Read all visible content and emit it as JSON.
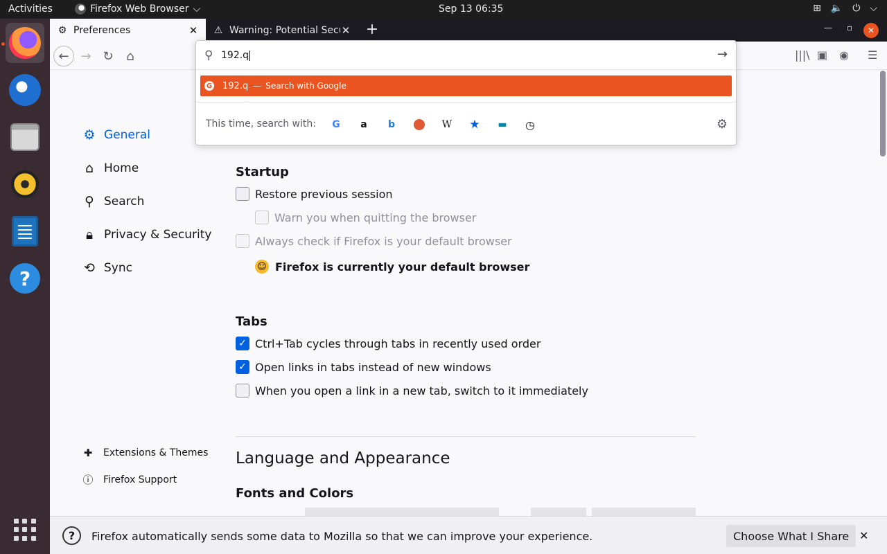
{
  "topbar": {
    "activities": "Activities",
    "app_name": "Firefox Web Browser",
    "clock": "Sep 13  06:35"
  },
  "dock": {
    "items": [
      "firefox",
      "thunderbird",
      "files",
      "rhythmbox",
      "libreoffice-writer",
      "help"
    ]
  },
  "tabs": [
    {
      "title": "Preferences",
      "icon": "gear-icon",
      "selected": true
    },
    {
      "title": "Warning: Potential Secur",
      "icon": "warning-icon",
      "selected": false
    }
  ],
  "urlbar": {
    "value": "192.q",
    "result": {
      "text": "192.q",
      "separator": "—",
      "action": "Search with Google"
    },
    "oneoff_label": "This time, search with:",
    "engines": [
      "google",
      "amazon",
      "bing",
      "duckduckgo",
      "wikipedia",
      "bookmarks",
      "tabs",
      "history"
    ]
  },
  "sidebar": {
    "categories": [
      {
        "label": "General",
        "icon": "gear-icon",
        "active": true
      },
      {
        "label": "Home",
        "icon": "home-icon"
      },
      {
        "label": "Search",
        "icon": "search-icon"
      },
      {
        "label": "Privacy & Security",
        "icon": "lock-icon"
      },
      {
        "label": "Sync",
        "icon": "sync-icon"
      }
    ],
    "footer": [
      {
        "label": "Extensions & Themes",
        "icon": "puzzle-icon"
      },
      {
        "label": "Firefox Support",
        "icon": "help-icon"
      }
    ]
  },
  "startup": {
    "heading": "Startup",
    "restore_session": {
      "label": "Restore previous session",
      "checked": false
    },
    "warn_quit": {
      "label": "Warn you when quitting the browser",
      "checked": false,
      "disabled": true
    },
    "always_check": {
      "label": "Always check if Firefox is your default browser",
      "checked": false,
      "disabled": true
    },
    "default_status": "Firefox is currently your default browser"
  },
  "tabs_section": {
    "heading": "Tabs",
    "ctrl_tab": {
      "label": "Ctrl+Tab cycles through tabs in recently used order",
      "checked": true
    },
    "open_links": {
      "label": "Open links in tabs instead of new windows",
      "checked": true
    },
    "switch_new": {
      "label": "When you open a link in a new tab, switch to it immediately",
      "checked": false
    }
  },
  "language": {
    "heading": "Language and Appearance",
    "fonts_heading": "Fonts and Colors"
  },
  "notification": {
    "message": "Firefox automatically sends some data to Mozilla so that we can improve your experience.",
    "button": "Choose What I Share",
    "close": "✕"
  },
  "colors": {
    "accent": "#0061e0",
    "highlight": "#e95420"
  }
}
